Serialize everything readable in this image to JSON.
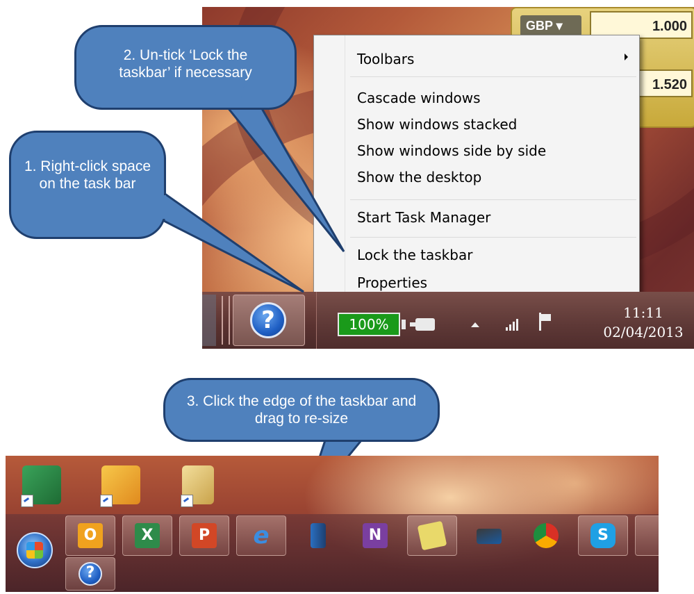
{
  "context_menu": {
    "toolbars": "Toolbars",
    "cascade": "Cascade windows",
    "stacked": "Show windows stacked",
    "side_by_side": "Show windows side by side",
    "show_desktop": "Show the desktop",
    "task_manager": "Start Task Manager",
    "lock_taskbar": "Lock the taskbar",
    "properties": "Properties"
  },
  "currency_gadget": {
    "currency": "GBP ▾",
    "value_top": "1.000",
    "value_bottom": "1.520"
  },
  "tray": {
    "battery_percent": "100%",
    "time": "11:11",
    "date": "02/04/2013",
    "help_glyph": "?"
  },
  "callouts": {
    "step1": "1. Right-click space on the task bar",
    "step2": "2. Un-tick ‘Lock the taskbar’ if necessary",
    "step3": "3. Click the edge of the taskbar and drag to re-size"
  },
  "icons": {
    "desktop": [
      "excel-shortcut-icon",
      "outlook-shortcut-icon",
      "folder-shortcut-icon"
    ],
    "taskbar": [
      "outlook-icon",
      "excel-icon",
      "powerpoint-icon",
      "internet-explorer-icon",
      "windows-explorer-icon",
      "onenote-icon",
      "sticky-notes-icon",
      "scanner-icon",
      "chrome-icon",
      "skype-icon",
      "help-icon"
    ]
  },
  "colors": {
    "callout_fill": "#4f81bd",
    "callout_border": "#1f3f6e",
    "battery_green": "#1a9a1a"
  }
}
